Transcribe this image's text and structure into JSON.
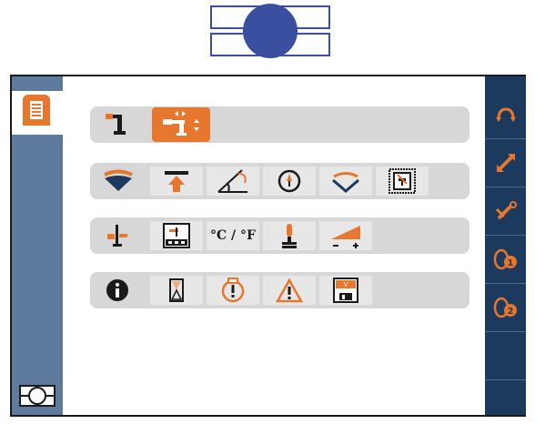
{
  "header": {
    "logo_icon": "company-logo-icon"
  },
  "sidebar": {
    "home_icon": "document-list-icon",
    "footer_icon": "screen-layout-icon"
  },
  "rows": [
    {
      "name": "tool-row",
      "items": [
        "crane-arm-icon",
        "crane-arm-adjust-icon"
      ]
    },
    {
      "name": "geometry-row",
      "items": [
        "tilt-indicator-icon",
        "top-limit-icon",
        "angle-measure-icon",
        "compass-icon",
        "rotate-tilt-icon",
        "display-frame-icon"
      ]
    },
    {
      "name": "settings-row",
      "items": [
        "calibration-icon",
        "display-settings-icon",
        "unit-toggle",
        "joystick-icon",
        "sensitivity-icon"
      ],
      "unit_label": "°C / °F"
    },
    {
      "name": "info-row",
      "items": [
        "info-icon",
        "hourglass-icon",
        "service-alert-icon",
        "warning-icon",
        "save-version-icon"
      ]
    }
  ],
  "right_menu": {
    "items": [
      "rotation-icon",
      "extension-icon",
      "extension-settings-icon",
      "winch-1-icon",
      "winch-2-icon",
      "empty-slot-1",
      "empty-slot-2"
    ],
    "badges": [
      "1",
      "2"
    ]
  },
  "colors": {
    "accent": "#e8772e",
    "sidebar": "#5e7a9c",
    "right_bar": "#1c3a5e",
    "logo": "#3a4fa0"
  }
}
